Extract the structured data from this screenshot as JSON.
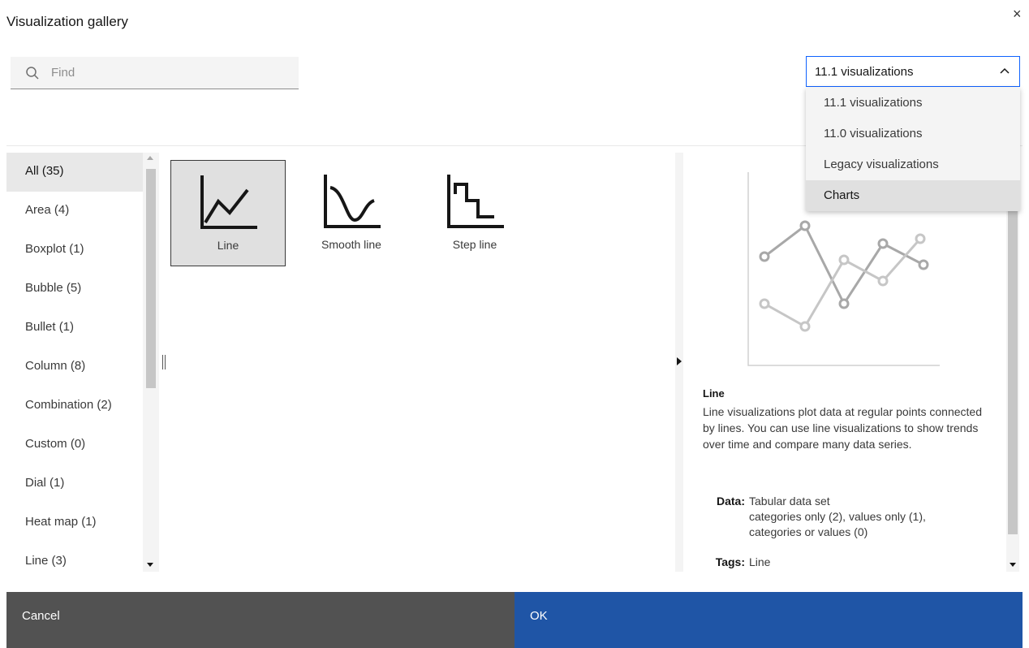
{
  "dialog": {
    "title": "Visualization gallery",
    "close_glyph": "×"
  },
  "search": {
    "placeholder": "Find",
    "value": "",
    "icon": "search-icon"
  },
  "version_select": {
    "selected": "11.1 visualizations",
    "expanded": true,
    "options": [
      "11.1 visualizations",
      "11.0 visualizations",
      "Legacy visualizations",
      "Charts"
    ],
    "highlighted_index": 3
  },
  "categories": [
    {
      "label": "All (35)",
      "selected": true
    },
    {
      "label": "Area (4)"
    },
    {
      "label": "Boxplot (1)"
    },
    {
      "label": "Bubble (5)"
    },
    {
      "label": "Bullet (1)"
    },
    {
      "label": "Column (8)"
    },
    {
      "label": "Combination (2)"
    },
    {
      "label": "Custom (0)"
    },
    {
      "label": "Dial (1)"
    },
    {
      "label": "Heat map (1)"
    },
    {
      "label": "Line (3)"
    }
  ],
  "gallery": {
    "tiles": [
      {
        "label": "Line",
        "icon": "line-chart-icon",
        "selected": true
      },
      {
        "label": "Smooth line",
        "icon": "smooth-line-chart-icon"
      },
      {
        "label": "Step line",
        "icon": "step-line-chart-icon"
      }
    ]
  },
  "preview": {
    "name": "Line",
    "description": "Line visualizations plot data at regular points connected by lines. You can use line visualizations to show trends over time and compare many data series.",
    "data_label": "Data:",
    "data_lines": [
      "Tabular data set",
      "categories only (2),  values only (1),",
      "categories or values (0)"
    ],
    "tags_label": "Tags:",
    "tags": "Line"
  },
  "footer": {
    "cancel_label": "Cancel",
    "ok_label": "OK",
    "ok_color": "#1f55a6",
    "cancel_color": "#525252"
  }
}
